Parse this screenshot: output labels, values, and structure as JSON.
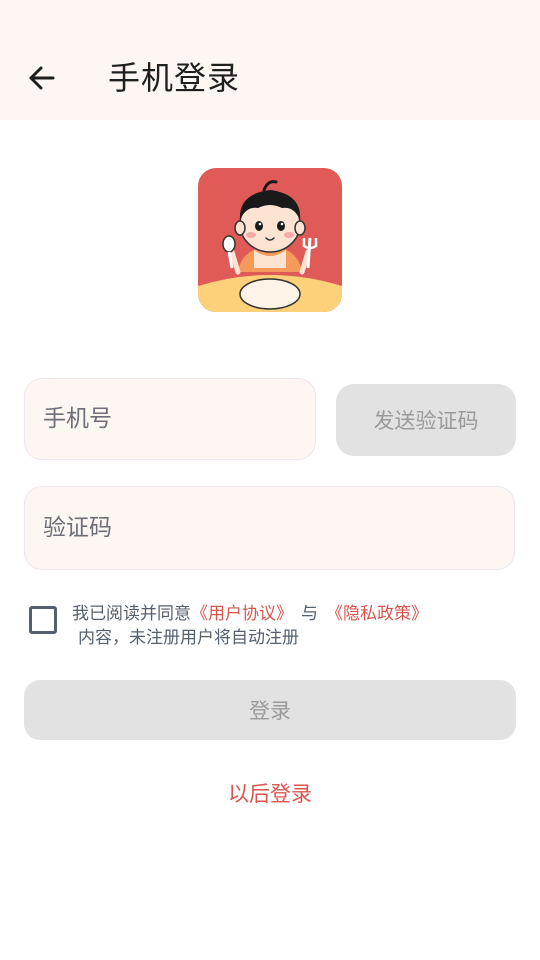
{
  "header": {
    "title": "手机登录",
    "back_icon": "arrow-left-icon"
  },
  "logo": {
    "icon": "app-logo-boy-eating",
    "colors": {
      "background": "#e05a58",
      "table": "#fdd07a",
      "plate": "#fdf3e6",
      "skin": "#fde4d2",
      "hair": "#1a1a1a",
      "shirt": "#f59a5a"
    }
  },
  "form": {
    "phone_placeholder": "手机号",
    "phone_value": "",
    "send_code_label": "发送验证码",
    "code_placeholder": "验证码",
    "code_value": ""
  },
  "agreement": {
    "checked": false,
    "prefix": "我已阅读并同意",
    "user_agreement": "《用户协议》",
    "connector": "与",
    "privacy_policy": "《隐私政策》",
    "suffix": "内容，未注册用户将自动注册"
  },
  "actions": {
    "login_label": "登录",
    "later_label": "以后登录"
  },
  "colors": {
    "accent": "#d9564f",
    "header_bg": "#fdf6f2",
    "disabled_bg": "#e2e2e2",
    "disabled_text": "#9a9a9a"
  }
}
